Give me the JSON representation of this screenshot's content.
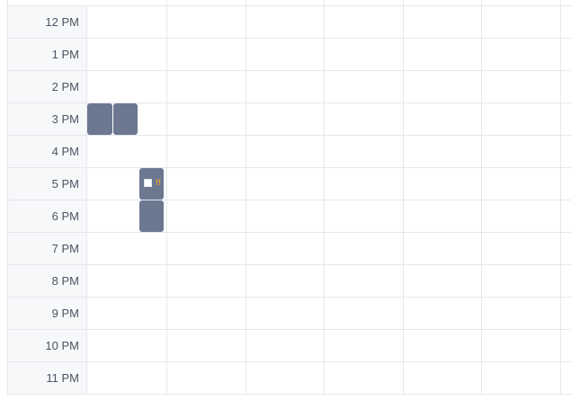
{
  "time_labels": [
    "12 PM",
    "1 PM",
    "2 PM",
    "3 PM",
    "4 PM",
    "5 PM",
    "6 PM",
    "7 PM",
    "8 PM",
    "9 PM",
    "10 PM",
    "11 PM"
  ],
  "events": {
    "event_a": {
      "name": "calendar-event"
    },
    "event_b": {
      "name": "calendar-event"
    },
    "event_c": {
      "name": "calendar-event",
      "warning_glyph": "!!"
    },
    "event_d": {
      "name": "calendar-event"
    }
  },
  "colors": {
    "event": "#6b7890",
    "warning": "#f5a623",
    "grid": "#e5e7eb",
    "time_column": "#f7f8fa"
  }
}
